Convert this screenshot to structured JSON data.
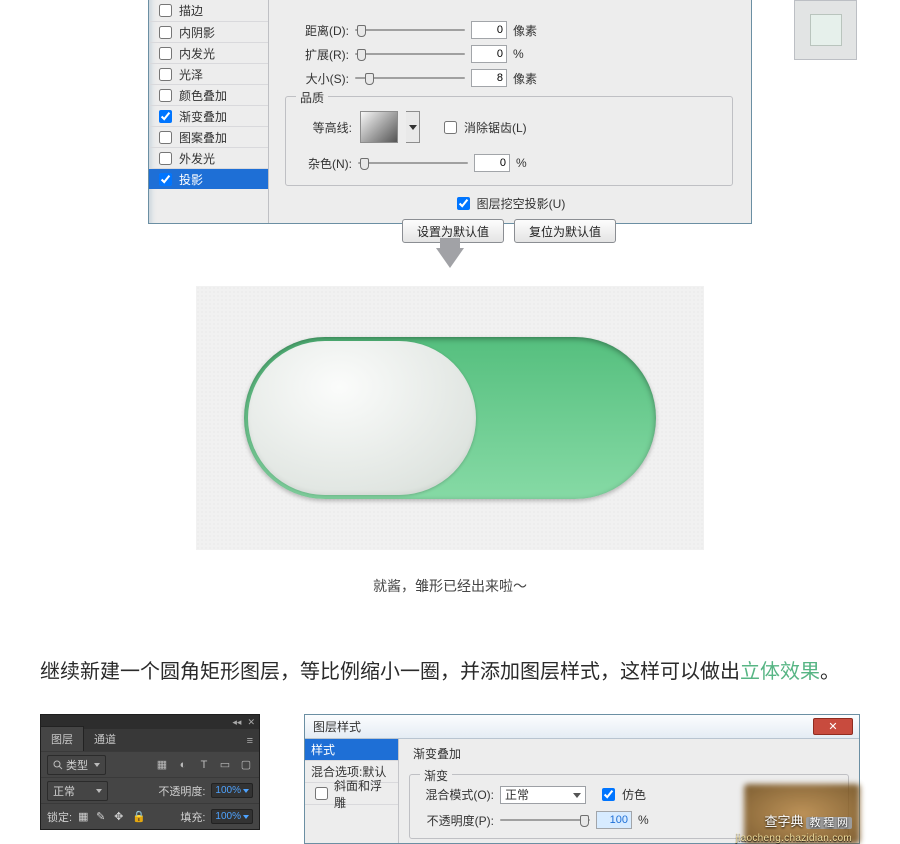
{
  "layerStyle1": {
    "styles": [
      {
        "label": "描边",
        "checked": false
      },
      {
        "label": "内阴影",
        "checked": false
      },
      {
        "label": "内发光",
        "checked": false
      },
      {
        "label": "光泽",
        "checked": false
      },
      {
        "label": "颜色叠加",
        "checked": false
      },
      {
        "label": "渐变叠加",
        "checked": true
      },
      {
        "label": "图案叠加",
        "checked": false
      },
      {
        "label": "外发光",
        "checked": false
      },
      {
        "label": "投影",
        "checked": true,
        "selected": true
      }
    ],
    "rows": {
      "distance": {
        "label": "距离(D):",
        "value": "0",
        "unit": "像素",
        "pos": 2
      },
      "spread": {
        "label": "扩展(R):",
        "value": "0",
        "unit": "%",
        "pos": 2
      },
      "size": {
        "label": "大小(S):",
        "value": "8",
        "unit": "像素",
        "pos": 10
      }
    },
    "quality": {
      "legend": "品质",
      "contour": "等高线:",
      "antialias": "消除锯齿(L)",
      "noise": {
        "label": "杂色(N):",
        "value": "0",
        "unit": "%",
        "pos": 2
      }
    },
    "knockout": "图层挖空投影(U)",
    "btn_default": "设置为默认值",
    "btn_reset": "复位为默认值"
  },
  "caption": "就酱，雏形已经出来啦～",
  "paragraph": {
    "t1": "继续新建一个圆角矩形图层，等比例缩小一圈，并添加图层样式，这样可以做出",
    "accent": "立体效果",
    "t2": "。"
  },
  "layersPanel": {
    "tabs": [
      "图层",
      "通道"
    ],
    "kind": "类型",
    "mode": "正常",
    "opacity_label": "不透明度:",
    "opacity_val": "100%",
    "lock_label": "锁定:",
    "fill_label": "填充:",
    "fill_val": "100%"
  },
  "layerStyle2": {
    "title": "图层样式",
    "styles": [
      {
        "label": "样式",
        "header": true
      },
      {
        "label": "混合选项:默认"
      },
      {
        "label": "斜面和浮雕",
        "cb": true
      }
    ],
    "group_outer": "渐变叠加",
    "group_inner": "渐变",
    "blendmode_label": "混合模式(O):",
    "blendmode_val": "正常",
    "dither": "仿色",
    "opacity_label": "不透明度(P):",
    "opacity_val": "100",
    "opacity_unit": "%"
  },
  "watermark": {
    "line1": "查字典",
    "tag": "教 程 网",
    "line2": "jiaocheng.chazidian.com"
  }
}
